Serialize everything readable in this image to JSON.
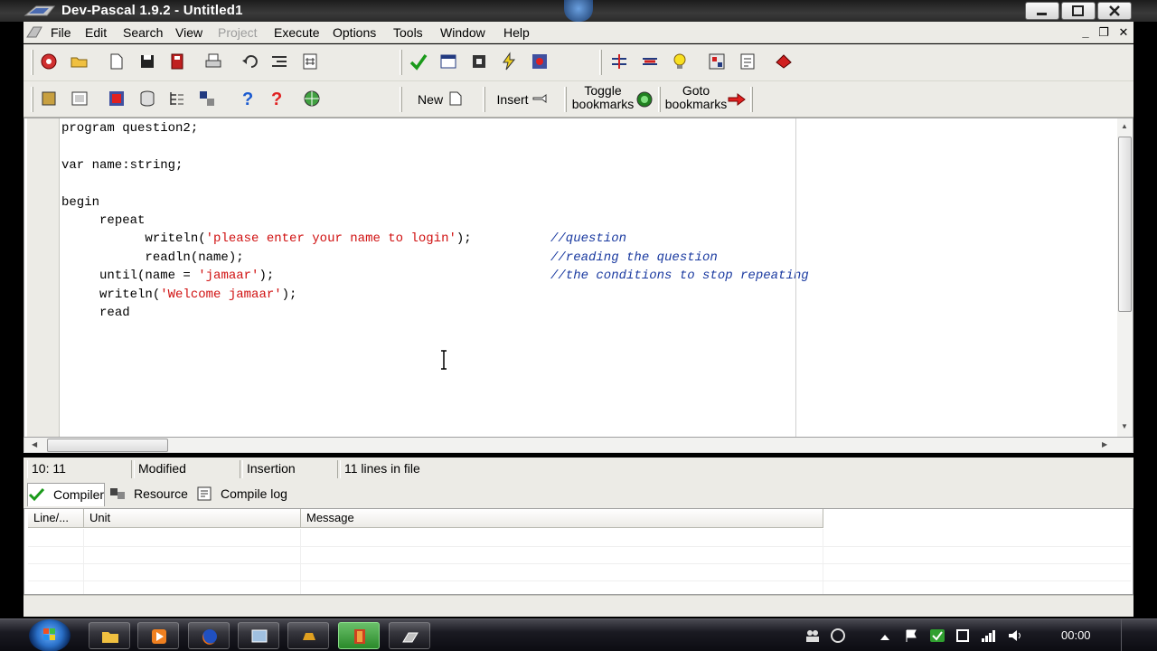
{
  "window": {
    "title": "Dev-Pascal 1.9.2 - Untitled1"
  },
  "menu": {
    "items": [
      {
        "label": "File",
        "enabled": true
      },
      {
        "label": "Edit",
        "enabled": true
      },
      {
        "label": "Search",
        "enabled": true
      },
      {
        "label": "View",
        "enabled": true
      },
      {
        "label": "Project",
        "enabled": false
      },
      {
        "label": "Execute",
        "enabled": true
      },
      {
        "label": "Options",
        "enabled": true
      },
      {
        "label": "Tools",
        "enabled": true
      },
      {
        "label": "Window",
        "enabled": true
      },
      {
        "label": "Help",
        "enabled": true
      }
    ]
  },
  "toolbar": {
    "new_label": "New",
    "insert_label": "Insert",
    "toggle_line1": "Toggle",
    "toggle_line2": "bookmarks",
    "goto_line1": "Goto",
    "goto_line2": "bookmarks"
  },
  "editor": {
    "lines": [
      {
        "indent": "",
        "parts": [
          {
            "t": "program question2;",
            "c": "kw"
          }
        ]
      },
      {
        "indent": "",
        "parts": []
      },
      {
        "indent": "",
        "parts": [
          {
            "t": "var name:string;",
            "c": "kw"
          }
        ]
      },
      {
        "indent": "",
        "parts": []
      },
      {
        "indent": "",
        "parts": [
          {
            "t": "begin",
            "c": "kw"
          }
        ]
      },
      {
        "indent": "     ",
        "parts": [
          {
            "t": "repeat",
            "c": "kw"
          }
        ]
      },
      {
        "indent": "           ",
        "parts": [
          {
            "t": "writeln(",
            "c": "kw"
          },
          {
            "t": "'please enter your name to login'",
            "c": "str"
          },
          {
            "t": ");",
            "c": "kw"
          }
        ]
      },
      {
        "indent": "           ",
        "parts": [
          {
            "t": "readln(name);",
            "c": "kw"
          }
        ]
      },
      {
        "indent": "     ",
        "parts": [
          {
            "t": "until(name = ",
            "c": "kw"
          },
          {
            "t": "'jamaar'",
            "c": "str"
          },
          {
            "t": ");",
            "c": "kw"
          }
        ]
      },
      {
        "indent": "     ",
        "parts": [
          {
            "t": "writeln(",
            "c": "kw"
          },
          {
            "t": "'Welcome jamaar'",
            "c": "str"
          },
          {
            "t": ");",
            "c": "kw"
          }
        ]
      },
      {
        "indent": "     ",
        "parts": [
          {
            "t": "read",
            "c": "kw"
          }
        ]
      }
    ],
    "comments": [
      {
        "line": 6,
        "text": "//question"
      },
      {
        "line": 7,
        "text": "//reading the question"
      },
      {
        "line": 8,
        "text": "//the conditions to stop repeating"
      }
    ]
  },
  "status": {
    "position": "10: 11",
    "modified": "Modified",
    "mode": "Insertion",
    "lines_info": "11 lines in file"
  },
  "tabs": [
    {
      "label": "Compiler",
      "active": true
    },
    {
      "label": "Resource",
      "active": false
    },
    {
      "label": "Compile log",
      "active": false
    }
  ],
  "messages": {
    "columns": [
      "Line/...",
      "Unit",
      "Message"
    ]
  },
  "taskbar": {
    "clock": "00:00"
  },
  "colors": {
    "string": "#d01010",
    "comment": "#1a3aa0",
    "chrome": "#ecebe6"
  }
}
